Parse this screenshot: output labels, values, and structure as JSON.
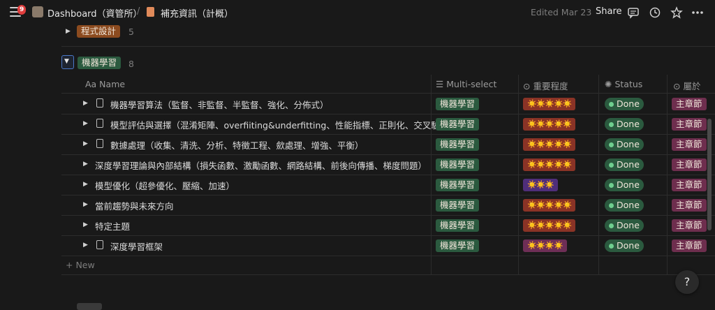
{
  "topbar": {
    "notifications": "9",
    "breadcrumb_root": "Dashboard（資管所）",
    "separator": "/",
    "breadcrumb_page": "補充資訊（計概）",
    "edited": "Edited Mar 23",
    "share": "Share"
  },
  "groups": [
    {
      "label": "程式設計",
      "count": "5",
      "color": "#8c4b1f"
    },
    {
      "label": "機器學習",
      "count": "8",
      "color": "#2b5a3f"
    }
  ],
  "columns": {
    "name": "Aa Name",
    "multi": "Multi-select",
    "importance": "重要程度",
    "status": "Status",
    "belongs": "屬於"
  },
  "rows": [
    {
      "name": "機器學習算法（監督、非監督、半監督、強化、分佈式）",
      "has_icon": true,
      "tag": "機器學習",
      "stars": "☀️☀️☀️☀️☀️",
      "star_bg": "#8a3326",
      "status": "Done",
      "belong": "主章節"
    },
    {
      "name": "模型評估與選擇（混淆矩陣、overfiiting&underfitting、性能指標、正則化、交叉驗證",
      "has_icon": true,
      "tag": "機器學習",
      "stars": "☀️☀️☀️☀️☀️",
      "star_bg": "#8a3326",
      "status": "Done",
      "belong": "主章節"
    },
    {
      "name": "數據處理（收集、清洗、分析、特徵工程、歛處理、增強、平衡）",
      "has_icon": true,
      "tag": "機器學習",
      "stars": "☀️☀️☀️☀️☀️",
      "star_bg": "#8a3326",
      "status": "Done",
      "belong": "主章節"
    },
    {
      "name": "深度學習理論與內部結構（損失函數、激勵函數、網路結構、前後向傳播、梯度問題）",
      "has_icon": false,
      "tag": "機器學習",
      "stars": "☀️☀️☀️☀️☀️",
      "star_bg": "#8a3326",
      "status": "Done",
      "belong": "主章節"
    },
    {
      "name": "模型優化（超參優化、壓縮、加速）",
      "has_icon": false,
      "tag": "機器學習",
      "stars": "☀️☀️☀️",
      "star_bg": "#4f2e7a",
      "status": "Done",
      "belong": "主章節"
    },
    {
      "name": "當前趨勢與未來方向",
      "has_icon": false,
      "tag": "機器學習",
      "stars": "☀️☀️☀️☀️☀️",
      "star_bg": "#8a3326",
      "status": "Done",
      "belong": "主章節"
    },
    {
      "name": "特定主題",
      "has_icon": false,
      "tag": "機器學習",
      "stars": "☀️☀️☀️☀️☀️",
      "star_bg": "#8a3326",
      "status": "Done",
      "belong": "主章節"
    },
    {
      "name": "深度學習框架",
      "has_icon": true,
      "tag": "機器學習",
      "stars": "☀️☀️☀️☀️",
      "star_bg": "#6e2e56",
      "status": "Done",
      "belong": "主章節"
    }
  ],
  "new_label": "+ New",
  "help": "?"
}
